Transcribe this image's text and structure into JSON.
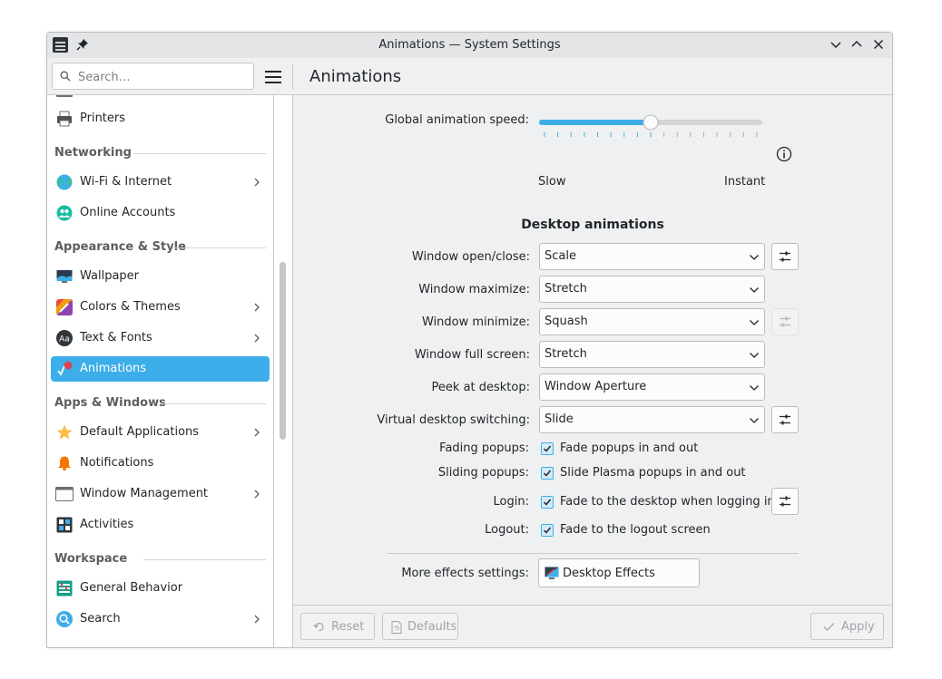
{
  "window": {
    "title": "Animations — System Settings"
  },
  "header": {
    "search_placeholder": "Search…",
    "page_title": "Animations"
  },
  "sidebar": {
    "items": [
      {
        "label": "Printers",
        "icon": "printer-icon"
      },
      {
        "label": "Wi-Fi & Internet",
        "icon": "globe-icon",
        "has_submenu": true
      },
      {
        "label": "Online Accounts",
        "icon": "accounts-icon"
      },
      {
        "label": "Wallpaper",
        "icon": "wallpaper-icon"
      },
      {
        "label": "Colors & Themes",
        "icon": "palette-icon",
        "has_submenu": true
      },
      {
        "label": "Text & Fonts",
        "icon": "fonts-icon",
        "has_submenu": true
      },
      {
        "label": "Animations",
        "icon": "animations-icon",
        "active": true
      },
      {
        "label": "Default Applications",
        "icon": "star-icon",
        "has_submenu": true
      },
      {
        "label": "Notifications",
        "icon": "bell-icon"
      },
      {
        "label": "Window Management",
        "icon": "window-icon",
        "has_submenu": true
      },
      {
        "label": "Activities",
        "icon": "activities-icon"
      },
      {
        "label": "General Behavior",
        "icon": "general-behavior-icon"
      },
      {
        "label": "Search",
        "icon": "search-icon",
        "has_submenu": true
      }
    ],
    "categories": [
      "Networking",
      "Appearance & Style",
      "Apps & Windows",
      "Workspace"
    ]
  },
  "speed": {
    "label": "Global animation speed:",
    "slow": "Slow",
    "instant": "Instant",
    "value_fraction": 0.5,
    "tick_count": 17
  },
  "section_title": "Desktop animations",
  "settings": [
    {
      "label": "Window open/close:",
      "value": "Scale",
      "configurable": true
    },
    {
      "label": "Window maximize:",
      "value": "Stretch",
      "configurable": false
    },
    {
      "label": "Window minimize:",
      "value": "Squash",
      "configurable": "disabled"
    },
    {
      "label": "Window full screen:",
      "value": "Stretch",
      "configurable": false
    },
    {
      "label": "Peek at desktop:",
      "value": "Window Aperture",
      "configurable": false
    },
    {
      "label": "Virtual desktop switching:",
      "value": "Slide",
      "configurable": true
    }
  ],
  "checks": [
    {
      "label": "Fading popups:",
      "text": "Fade popups in and out",
      "checked": true
    },
    {
      "label": "Sliding popups:",
      "text": "Slide Plasma popups in and out",
      "checked": true
    },
    {
      "label": "Login:",
      "text": "Fade to the desktop when logging in",
      "checked": true
    },
    {
      "label": "Logout:",
      "text": "Fade to the logout screen",
      "checked": true
    }
  ],
  "more": {
    "label": "More effects settings:",
    "button": "Desktop Effects"
  },
  "footer": {
    "reset": "Reset",
    "defaults": "Defaults",
    "apply": "Apply"
  },
  "colors": {
    "accent": "#3daee9",
    "window_bg": "#eff0f1",
    "text": "#232629"
  }
}
